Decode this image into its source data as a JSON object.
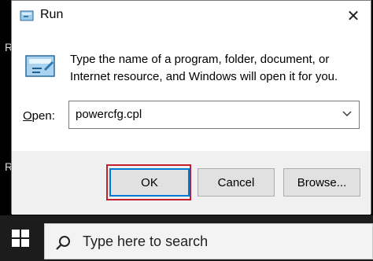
{
  "background": {
    "fragments": [
      "R",
      "R"
    ]
  },
  "dialog": {
    "title": "Run",
    "close_glyph": "✕",
    "description": "Type the name of a program, folder, document, or Internet resource, and Windows will open it for you.",
    "open_label_prefix": "O",
    "open_label_rest": "pen:",
    "open_value": "powercfg.cpl",
    "buttons": {
      "ok": "OK",
      "cancel": "Cancel",
      "browse": "Browse..."
    },
    "highlight_color": "#c2202e"
  },
  "taskbar": {
    "search_placeholder": "Type here to search"
  },
  "icons": {
    "title": "run-icon",
    "content": "run-icon",
    "dropdown": "chevron-down-icon",
    "start": "windows-logo-icon",
    "search": "search-icon",
    "close": "close-icon"
  }
}
